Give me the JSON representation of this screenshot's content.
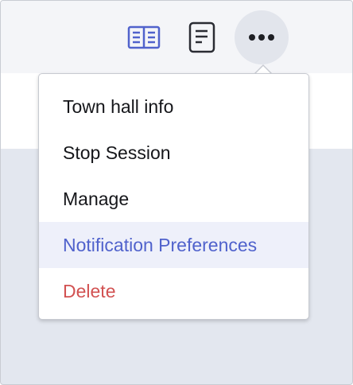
{
  "toolbar": {
    "icons": [
      "reader-view-icon",
      "notes-icon",
      "more-options-icon"
    ]
  },
  "menu": {
    "items": [
      {
        "label": "Town hall info"
      },
      {
        "label": "Stop Session"
      },
      {
        "label": "Manage"
      },
      {
        "label": "Notification Preferences"
      },
      {
        "label": "Delete"
      }
    ]
  },
  "colors": {
    "accent": "#5062cc",
    "danger": "#d25252",
    "highlight_bg": "#eef0fa",
    "toolbar_bg": "#f4f5f8",
    "page_bg": "#e3e7ef"
  }
}
